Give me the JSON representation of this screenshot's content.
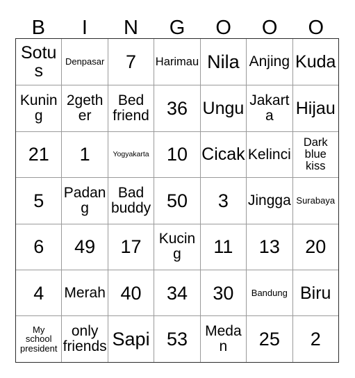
{
  "card": {
    "title": "BINGOOO",
    "headers": [
      "B",
      "I",
      "N",
      "G",
      "O",
      "O",
      "O"
    ],
    "grid_size": "7x7",
    "colors": {
      "background": "#ffffff",
      "text": "#000000",
      "inner_border": "#9a9a9a",
      "outer_border": "#2b2b2b"
    },
    "rows": [
      {
        "cells": [
          {
            "text": "Sotus",
            "size": "lg"
          },
          {
            "text": "Denpasar",
            "size": "xs"
          },
          {
            "text": "7",
            "size": "xl"
          },
          {
            "text": "Harimau",
            "size": "sm"
          },
          {
            "text": "Nila",
            "size": "xl"
          },
          {
            "text": "Anjing",
            "size": "md"
          },
          {
            "text": "Kuda",
            "size": "lg"
          }
        ]
      },
      {
        "cells": [
          {
            "text": "Kuning",
            "size": "md"
          },
          {
            "text": "2gether",
            "size": "md"
          },
          {
            "text": "Bed\nfriend",
            "size": "md"
          },
          {
            "text": "36",
            "size": "xl"
          },
          {
            "text": "Ungu",
            "size": "lg"
          },
          {
            "text": "Jakarta",
            "size": "md"
          },
          {
            "text": "Hijau",
            "size": "lg"
          }
        ]
      },
      {
        "cells": [
          {
            "text": "21",
            "size": "xl"
          },
          {
            "text": "1",
            "size": "xl"
          },
          {
            "text": "Yogyakarta",
            "size": "xxs"
          },
          {
            "text": "10",
            "size": "xl"
          },
          {
            "text": "Cicak",
            "size": "lg"
          },
          {
            "text": "Kelinci",
            "size": "md"
          },
          {
            "text": "Dark\nblue\nkiss",
            "size": "sm"
          }
        ]
      },
      {
        "cells": [
          {
            "text": "5",
            "size": "xl"
          },
          {
            "text": "Padang",
            "size": "md"
          },
          {
            "text": "Bad\nbuddy",
            "size": "md"
          },
          {
            "text": "50",
            "size": "xl"
          },
          {
            "text": "3",
            "size": "xl"
          },
          {
            "text": "Jingga",
            "size": "md"
          },
          {
            "text": "Surabaya",
            "size": "xs"
          }
        ]
      },
      {
        "cells": [
          {
            "text": "6",
            "size": "xl"
          },
          {
            "text": "49",
            "size": "xl"
          },
          {
            "text": "17",
            "size": "xl"
          },
          {
            "text": "Kucing",
            "size": "md"
          },
          {
            "text": "11",
            "size": "xl"
          },
          {
            "text": "13",
            "size": "xl"
          },
          {
            "text": "20",
            "size": "xl"
          }
        ]
      },
      {
        "cells": [
          {
            "text": "4",
            "size": "xl"
          },
          {
            "text": "Merah",
            "size": "md"
          },
          {
            "text": "40",
            "size": "xl"
          },
          {
            "text": "34",
            "size": "xl"
          },
          {
            "text": "30",
            "size": "xl"
          },
          {
            "text": "Bandung",
            "size": "xs"
          },
          {
            "text": "Biru",
            "size": "lg"
          }
        ]
      },
      {
        "cells": [
          {
            "text": "My\nschool\npresident",
            "size": "xs"
          },
          {
            "text": "only\nfriends",
            "size": "md"
          },
          {
            "text": "Sapi",
            "size": "xl"
          },
          {
            "text": "53",
            "size": "xl"
          },
          {
            "text": "Medan",
            "size": "md"
          },
          {
            "text": "25",
            "size": "xl"
          },
          {
            "text": "2",
            "size": "xl"
          }
        ]
      }
    ]
  }
}
